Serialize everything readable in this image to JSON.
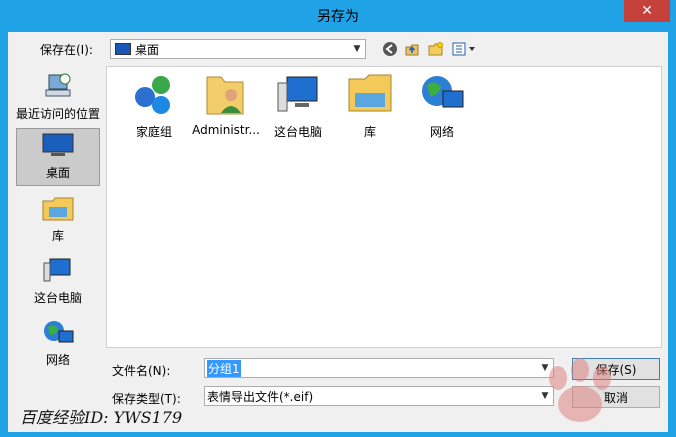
{
  "window": {
    "title": "另存为",
    "close_glyph": "✕"
  },
  "toolbar": {
    "save_in_label": "保存在(I):",
    "location": "桌面"
  },
  "places": [
    {
      "label": "最近访问的位置"
    },
    {
      "label": "桌面"
    },
    {
      "label": "库"
    },
    {
      "label": "这台电脑"
    },
    {
      "label": "网络"
    }
  ],
  "items": [
    {
      "label": "家庭组"
    },
    {
      "label": "Administr..."
    },
    {
      "label": "这台电脑"
    },
    {
      "label": "库"
    },
    {
      "label": "网络"
    }
  ],
  "filename": {
    "label": "文件名(N):",
    "value": "分组1"
  },
  "filetype": {
    "label": "保存类型(T):",
    "value": "表情导出文件(*.eif)"
  },
  "buttons": {
    "save": "保存(S)",
    "cancel": "取消"
  },
  "watermark": {
    "text": "百度经验ID: YWS179"
  },
  "colors": {
    "titlebar": "#1fa3e6",
    "close": "#c7413c",
    "selection": "#3399ff"
  }
}
